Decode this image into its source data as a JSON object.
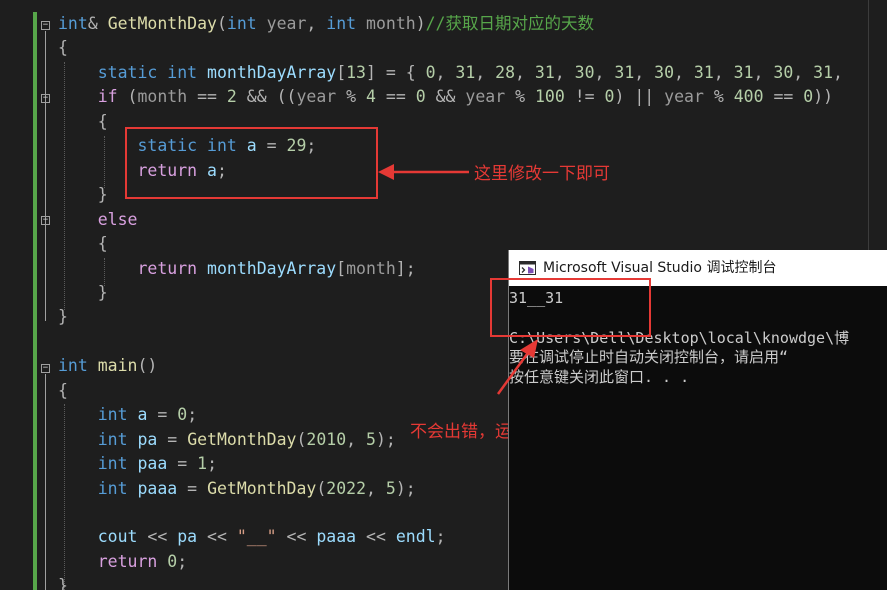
{
  "code_lines": [
    [
      [
        "kw",
        "int"
      ],
      [
        "pu",
        "& "
      ],
      [
        "fn",
        "GetMonthDay"
      ],
      [
        "pu",
        "("
      ],
      [
        "kw",
        "int"
      ],
      [
        "gray",
        " year"
      ],
      [
        "pu",
        ", "
      ],
      [
        "kw",
        "int"
      ],
      [
        "gray",
        " month"
      ],
      [
        "pu",
        ")"
      ],
      [
        "cm",
        "//获取日期对应的天数"
      ]
    ],
    [
      [
        "pu",
        "{"
      ]
    ],
    [
      [
        "pu",
        "    "
      ],
      [
        "kw",
        "static"
      ],
      [
        "pu",
        " "
      ],
      [
        "kw",
        "int"
      ],
      [
        "pu",
        " "
      ],
      [
        "id",
        "monthDayArray"
      ],
      [
        "pu",
        "["
      ],
      [
        "num",
        "13"
      ],
      [
        "pu",
        "] = { "
      ],
      [
        "num",
        "0"
      ],
      [
        "pu",
        ", "
      ],
      [
        "num",
        "31"
      ],
      [
        "pu",
        ", "
      ],
      [
        "num",
        "28"
      ],
      [
        "pu",
        ", "
      ],
      [
        "num",
        "31"
      ],
      [
        "pu",
        ", "
      ],
      [
        "num",
        "30"
      ],
      [
        "pu",
        ", "
      ],
      [
        "num",
        "31"
      ],
      [
        "pu",
        ", "
      ],
      [
        "num",
        "30"
      ],
      [
        "pu",
        ", "
      ],
      [
        "num",
        "31"
      ],
      [
        "pu",
        ", "
      ],
      [
        "num",
        "31"
      ],
      [
        "pu",
        ", "
      ],
      [
        "num",
        "30"
      ],
      [
        "pu",
        ", "
      ],
      [
        "num",
        "31"
      ],
      [
        "pu",
        ","
      ]
    ],
    [
      [
        "pu",
        "    "
      ],
      [
        "ctl",
        "if"
      ],
      [
        "pu",
        " ("
      ],
      [
        "gray",
        "month"
      ],
      [
        "pu",
        " == "
      ],
      [
        "num",
        "2"
      ],
      [
        "pu",
        " && (("
      ],
      [
        "gray",
        "year"
      ],
      [
        "pu",
        " % "
      ],
      [
        "num",
        "4"
      ],
      [
        "pu",
        " == "
      ],
      [
        "num",
        "0"
      ],
      [
        "pu",
        " && "
      ],
      [
        "gray",
        "year"
      ],
      [
        "pu",
        " % "
      ],
      [
        "num",
        "100"
      ],
      [
        "pu",
        " != "
      ],
      [
        "num",
        "0"
      ],
      [
        "pu",
        ") || "
      ],
      [
        "gray",
        "year"
      ],
      [
        "pu",
        " % "
      ],
      [
        "num",
        "400"
      ],
      [
        "pu",
        " == "
      ],
      [
        "num",
        "0"
      ],
      [
        "pu",
        "))"
      ]
    ],
    [
      [
        "pu",
        "    {"
      ]
    ],
    [
      [
        "pu",
        "        "
      ],
      [
        "kw",
        "static"
      ],
      [
        "pu",
        " "
      ],
      [
        "kw",
        "int"
      ],
      [
        "pu",
        " "
      ],
      [
        "id",
        "a"
      ],
      [
        "pu",
        " = "
      ],
      [
        "num",
        "29"
      ],
      [
        "pu",
        ";"
      ]
    ],
    [
      [
        "pu",
        "        "
      ],
      [
        "ctl",
        "return"
      ],
      [
        "pu",
        " "
      ],
      [
        "id",
        "a"
      ],
      [
        "pu",
        ";"
      ]
    ],
    [
      [
        "pu",
        "    }"
      ]
    ],
    [
      [
        "pu",
        "    "
      ],
      [
        "ctl",
        "else"
      ]
    ],
    [
      [
        "pu",
        "    {"
      ]
    ],
    [
      [
        "pu",
        "        "
      ],
      [
        "ctl",
        "return"
      ],
      [
        "pu",
        " "
      ],
      [
        "id",
        "monthDayArray"
      ],
      [
        "pu",
        "["
      ],
      [
        "gray",
        "month"
      ],
      [
        "pu",
        "];"
      ]
    ],
    [
      [
        "pu",
        "    }"
      ]
    ],
    [
      [
        "pu",
        "}"
      ]
    ],
    [],
    [
      [
        "kw",
        "int"
      ],
      [
        "pu",
        " "
      ],
      [
        "fn",
        "main"
      ],
      [
        "pu",
        "()"
      ]
    ],
    [
      [
        "pu",
        "{"
      ]
    ],
    [
      [
        "pu",
        "    "
      ],
      [
        "kw",
        "int"
      ],
      [
        "pu",
        " "
      ],
      [
        "id",
        "a"
      ],
      [
        "pu",
        " = "
      ],
      [
        "num",
        "0"
      ],
      [
        "pu",
        ";"
      ]
    ],
    [
      [
        "pu",
        "    "
      ],
      [
        "kw",
        "int"
      ],
      [
        "pu",
        " "
      ],
      [
        "id",
        "pa"
      ],
      [
        "pu",
        " = "
      ],
      [
        "fn",
        "GetMonthDay"
      ],
      [
        "pu",
        "("
      ],
      [
        "num",
        "2010"
      ],
      [
        "pu",
        ", "
      ],
      [
        "num",
        "5"
      ],
      [
        "pu",
        ");"
      ]
    ],
    [
      [
        "pu",
        "    "
      ],
      [
        "kw",
        "int"
      ],
      [
        "pu",
        " "
      ],
      [
        "id",
        "paa"
      ],
      [
        "pu",
        " = "
      ],
      [
        "num",
        "1"
      ],
      [
        "pu",
        ";"
      ]
    ],
    [
      [
        "pu",
        "    "
      ],
      [
        "kw",
        "int"
      ],
      [
        "pu",
        " "
      ],
      [
        "id",
        "paaa"
      ],
      [
        "pu",
        " = "
      ],
      [
        "fn",
        "GetMonthDay"
      ],
      [
        "pu",
        "("
      ],
      [
        "num",
        "2022"
      ],
      [
        "pu",
        ", "
      ],
      [
        "num",
        "5"
      ],
      [
        "pu",
        ");"
      ]
    ],
    [],
    [
      [
        "pu",
        "    "
      ],
      [
        "id",
        "cout"
      ],
      [
        "pu",
        " << "
      ],
      [
        "id",
        "pa"
      ],
      [
        "pu",
        " << "
      ],
      [
        "st",
        "\"__\""
      ],
      [
        "pu",
        " << "
      ],
      [
        "id",
        "paaa"
      ],
      [
        "pu",
        " << "
      ],
      [
        "id",
        "endl"
      ],
      [
        "pu",
        ";"
      ]
    ],
    [
      [
        "pu",
        "    "
      ],
      [
        "ctl",
        "return"
      ],
      [
        "pu",
        " "
      ],
      [
        "num",
        "0"
      ],
      [
        "pu",
        ";"
      ]
    ],
    [
      [
        "pu",
        "}"
      ]
    ]
  ],
  "annotations": {
    "modify_here": "这里修改一下即可",
    "no_error": "不会出错，运行成功"
  },
  "console": {
    "title": "Microsoft Visual Studio 调试控制台",
    "lines": [
      "31__31",
      "",
      "C:\\Users\\Dell\\Desktop\\local\\knowdge\\博",
      "要在调试停止时自动关闭控制台，请启用“",
      "按任意键关闭此窗口. . ."
    ]
  },
  "colors": {
    "editor_bg": "#1e1e1e",
    "keyword": "#569cd6",
    "function": "#dcdcaa",
    "comment": "#57a64a",
    "number": "#b5cea8",
    "annotation_red": "#e53935",
    "console_bg": "#0c0c0c"
  }
}
